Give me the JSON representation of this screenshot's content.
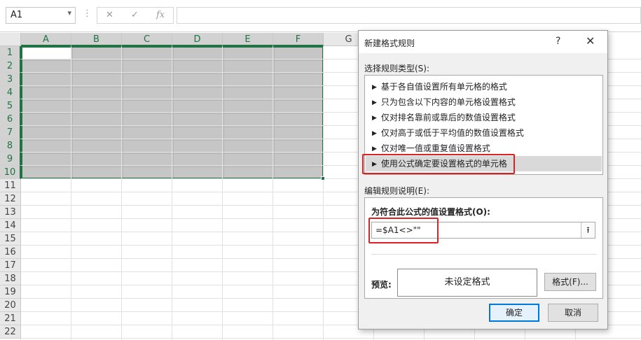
{
  "formula_bar": {
    "name_box": "A1",
    "separator": "⋮",
    "cancel_icon": "✕",
    "enter_icon": "✓",
    "fx_label": "fx",
    "formula": ""
  },
  "sheet": {
    "columns": [
      "A",
      "B",
      "C",
      "D",
      "E",
      "F",
      "G"
    ],
    "rows": [
      "1",
      "2",
      "3",
      "4",
      "5",
      "6",
      "7",
      "8",
      "9",
      "10",
      "11",
      "12",
      "13",
      "14",
      "15",
      "16",
      "17",
      "18",
      "19",
      "20",
      "21",
      "22"
    ],
    "selected_range": "A1:F10",
    "selection_color": "#217346"
  },
  "dialog": {
    "title": "新建格式规则",
    "help": "?",
    "close": "✕",
    "rule_type_label": "选择规则类型(S):",
    "rule_types": [
      {
        "label": "基于各自值设置所有单元格的格式",
        "selected": false
      },
      {
        "label": "只为包含以下内容的单元格设置格式",
        "selected": false
      },
      {
        "label": "仅对排名靠前或靠后的数值设置格式",
        "selected": false
      },
      {
        "label": "仅对高于或低于平均值的数值设置格式",
        "selected": false
      },
      {
        "label": "仅对唯一值或重复值设置格式",
        "selected": false
      },
      {
        "label": "使用公式确定要设置格式的单元格",
        "selected": true
      }
    ],
    "edit_label": "编辑规则说明(E):",
    "formula_label": "为符合此公式的值设置格式(O):",
    "formula_value": "=$A1<>\"\"",
    "collapse_icon": "⭱",
    "preview_label": "预览:",
    "preview_text": "未设定格式",
    "format_button": "格式(F)...",
    "ok_button": "确定",
    "cancel_button": "取消",
    "highlight_color": "#e02020"
  }
}
